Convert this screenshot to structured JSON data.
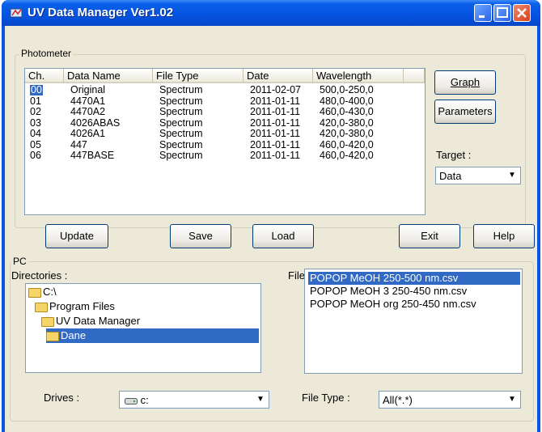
{
  "window": {
    "title": "UV Data Manager Ver1.02"
  },
  "photometer": {
    "legend": "Photometer",
    "columns": [
      "Ch.",
      "Data Name",
      "File Type",
      "Date",
      "Wavelength"
    ],
    "rows": [
      {
        "ch": "00",
        "name": "Original",
        "type": "Spectrum",
        "date": "2011-02-07",
        "wl": "500,0-250,0"
      },
      {
        "ch": "01",
        "name": "4470A1",
        "type": "Spectrum",
        "date": "2011-01-11",
        "wl": "480,0-400,0"
      },
      {
        "ch": "02",
        "name": "4470A2",
        "type": "Spectrum",
        "date": "2011-01-11",
        "wl": "460,0-430,0"
      },
      {
        "ch": "03",
        "name": "4026ABAS",
        "type": "Spectrum",
        "date": "2011-01-11",
        "wl": "420,0-380,0"
      },
      {
        "ch": "04",
        "name": "4026A1",
        "type": "Spectrum",
        "date": "2011-01-11",
        "wl": "420,0-380,0"
      },
      {
        "ch": "05",
        "name": "447",
        "type": "Spectrum",
        "date": "2011-01-11",
        "wl": "460,0-420,0"
      },
      {
        "ch": "06",
        "name": "447BASE",
        "type": "Spectrum",
        "date": "2011-01-11",
        "wl": "460,0-420,0"
      }
    ],
    "graph_label": "Graph",
    "parameters_label": "Parameters",
    "target_label": "Target :",
    "target_value": "Data"
  },
  "actions": {
    "update": "Update",
    "save": "Save",
    "load": "Load",
    "exit": "Exit",
    "help": "Help"
  },
  "pc": {
    "legend": "PC",
    "directories_label": "Directories :",
    "directories": [
      "C:\\",
      "Program Files",
      "UV Data Manager",
      "Dane"
    ],
    "files_label": "Files :",
    "files": [
      "POPOP MeOH 250-500 nm.csv",
      "POPOP MeOH 3 250-450 nm.csv",
      "POPOP MeOH org 250-450 nm.csv"
    ],
    "drives_label": "Drives :",
    "drive_value": "c:",
    "filetype_label": "File Type :",
    "filetype_value": "All(*.*)"
  },
  "colors": {
    "titlebar": "#0553e0",
    "selection": "#316ac5",
    "face": "#ece9d8"
  }
}
